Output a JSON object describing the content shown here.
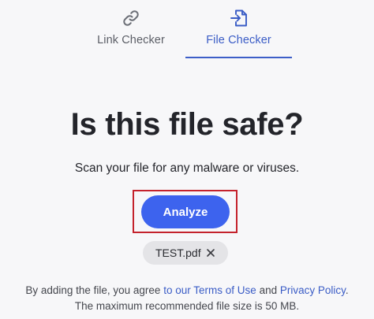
{
  "tabs": [
    {
      "label": "Link Checker",
      "icon": "link-icon",
      "active": false
    },
    {
      "label": "File Checker",
      "icon": "file-import-icon",
      "active": true
    }
  ],
  "main": {
    "title": "Is this file safe?",
    "subtitle": "Scan your file for any malware or viruses.",
    "analyze_label": "Analyze",
    "file_name": "TEST.pdf",
    "remove_icon": "close-icon"
  },
  "footer": {
    "agree_prefix": "By adding the file, you agree",
    "link_to_our": "to our",
    "terms_link": "Terms of Use",
    "and_text": "and",
    "privacy_link": "Privacy Policy",
    "period": ".",
    "max_size_text": "The maximum recommended file size is 50 MB."
  },
  "colors": {
    "accent": "#3d63ee",
    "tab_active": "#3a5cc6",
    "highlight": "#c4222c",
    "chip_bg": "#e4e4e7",
    "background": "#f7f7f9"
  }
}
